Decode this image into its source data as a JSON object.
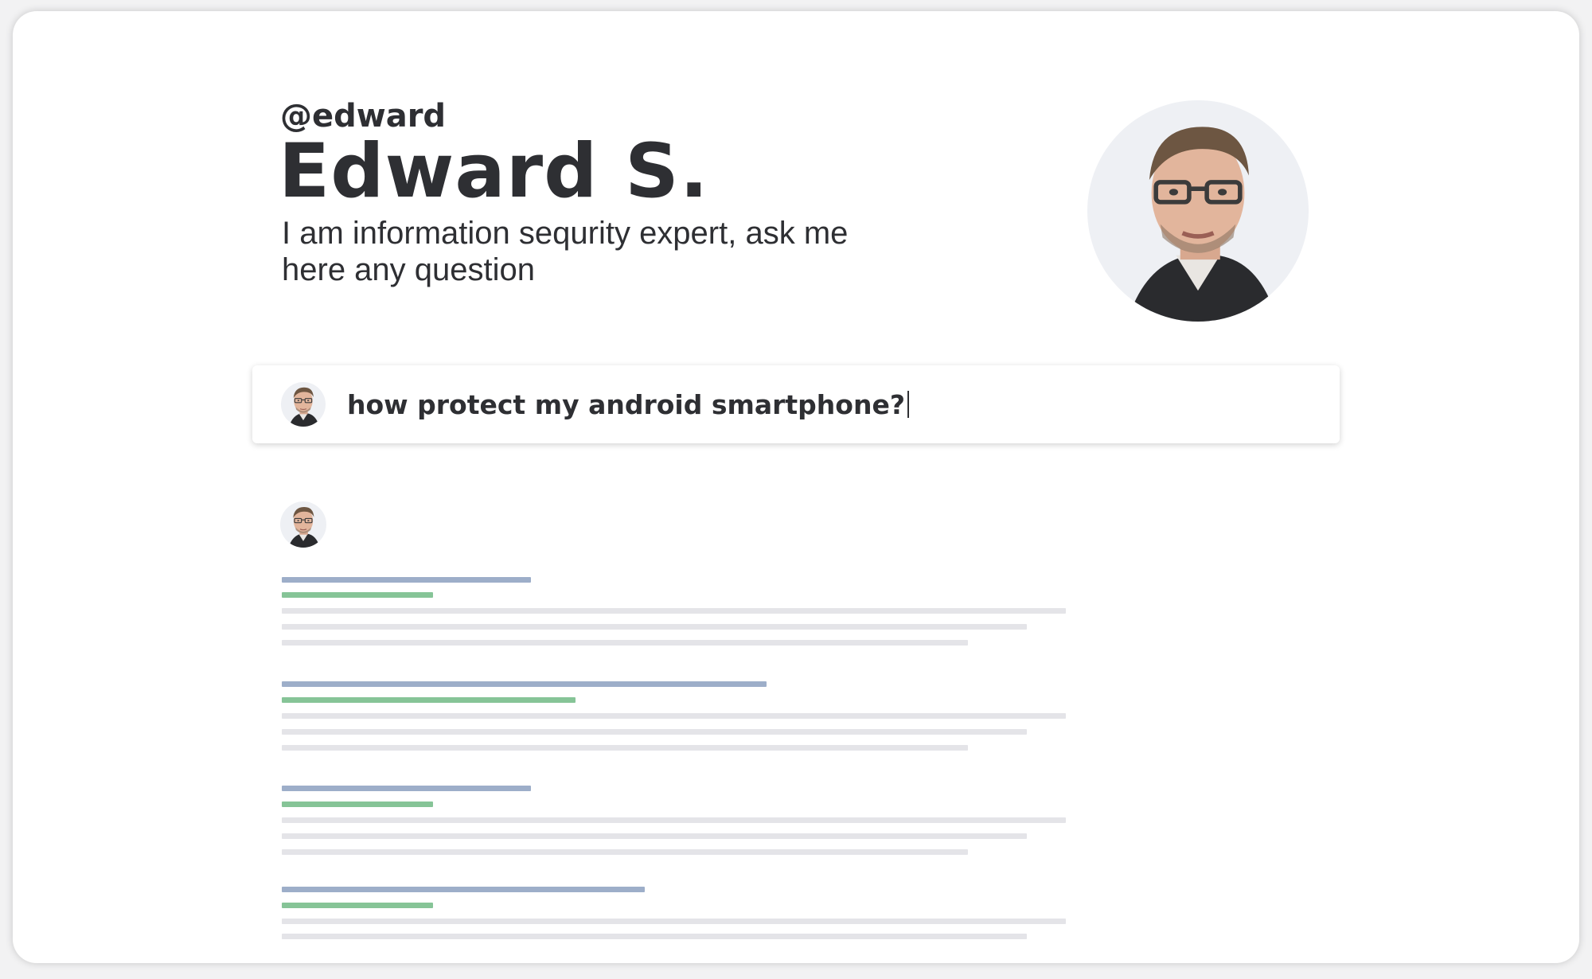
{
  "profile": {
    "handle": "@edward",
    "name": "Edward S.",
    "bio": "I am information sequrity expert, ask me here any question",
    "photo_icon": "user-portrait-icon"
  },
  "question": {
    "text": "how protect my android smartphone?",
    "avatar_icon": "user-portrait-icon"
  },
  "answers": {
    "avatar_icon": "user-portrait-icon",
    "placeholder_blocks": 4
  },
  "colors": {
    "text": "#2e2f33",
    "placeholder_title": "#9daec9",
    "placeholder_subtitle": "#86c497",
    "placeholder_text": "#e4e4e8"
  }
}
